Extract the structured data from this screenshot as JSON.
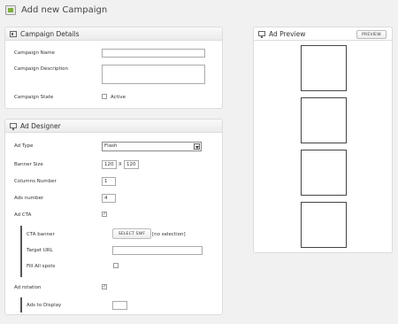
{
  "page": {
    "title": "Add new Campaign",
    "icon": "campaign-icon"
  },
  "campaign_details": {
    "title": "Campaign Details",
    "name_label": "Campaign Name",
    "name_value": "",
    "description_label": "Campaign Description",
    "description_value": "",
    "state_label": "Campaign State",
    "state_checkbox_label": "Active",
    "state_checked": false
  },
  "ad_designer": {
    "title": "Ad Designer",
    "ad_type_label": "Ad Type",
    "ad_type_value": "Flash",
    "banner_size_label": "Banner Size",
    "banner_width": "120",
    "banner_x": "X",
    "banner_height": "120",
    "columns_label": "Columns Number",
    "columns_value": "1",
    "ads_number_label": "Ads number",
    "ads_number_value": "4",
    "ad_cta_label": "Ad CTA",
    "ad_cta_checked": true,
    "cta_banner_label": "CTA banner",
    "select_swf_label": "SELECT SWF",
    "cta_banner_value": "[no selection]",
    "target_url_label": "Target URL",
    "target_url_value": "",
    "fill_all_spots_label": "Fill All spots",
    "fill_all_spots_checked": false,
    "ad_rotation_label": "Ad rotation",
    "ad_rotation_checked": true,
    "ads_to_display_label": "Ads to Display",
    "ads_to_display_value": ""
  },
  "ad_preview": {
    "title": "Ad Preview",
    "preview_button_label": "PREVIEW",
    "slot_count": 4
  },
  "colors": {
    "accent": "#7fae3e",
    "panel_border": "#dcdcdc",
    "background": "#f1f1f1"
  }
}
